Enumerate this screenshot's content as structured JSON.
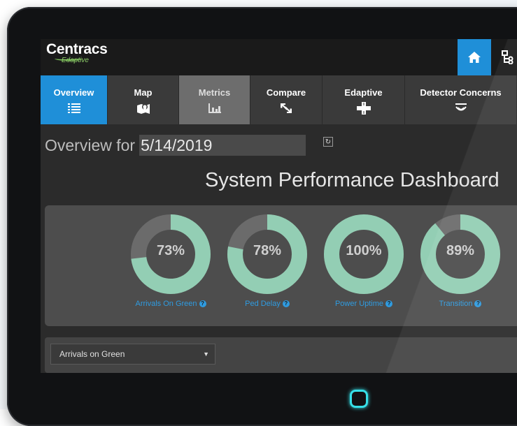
{
  "brand": {
    "name": "Centracs",
    "sub": "Edaptive"
  },
  "topbar": {
    "home_icon": "home-icon",
    "org_icon": "sitemap-icon"
  },
  "nav": {
    "items": [
      {
        "label": "Overview",
        "icon": "list-icon"
      },
      {
        "label": "Map",
        "icon": "map-pin-icon"
      },
      {
        "label": "Metrics",
        "icon": "bar-chart-icon"
      },
      {
        "label": "Compare",
        "icon": "arrows-icon"
      },
      {
        "label": "Edaptive",
        "icon": "intersection-icon"
      },
      {
        "label": "Detector Concerns",
        "icon": "detector-icon"
      }
    ]
  },
  "overview": {
    "label": "Overview for",
    "date": "5/14/2019"
  },
  "dashboard": {
    "title": "System Performance Dashboard",
    "gauges": [
      {
        "value_text": "73%",
        "value": 73,
        "label": "Arrivals On Green"
      },
      {
        "value_text": "78%",
        "value": 78,
        "label": "Ped Delay"
      },
      {
        "value_text": "100%",
        "value": 100,
        "label": "Power Uptime"
      },
      {
        "value_text": "89%",
        "value": 89,
        "label": "Transition"
      }
    ]
  },
  "metric_select": {
    "selected": "Arrivals on Green"
  },
  "colors": {
    "accent_blue": "#1f8fd8",
    "gauge_fill": "#93ceb4",
    "gauge_track": "#6b6b6b",
    "link_blue": "#2f9be0"
  }
}
